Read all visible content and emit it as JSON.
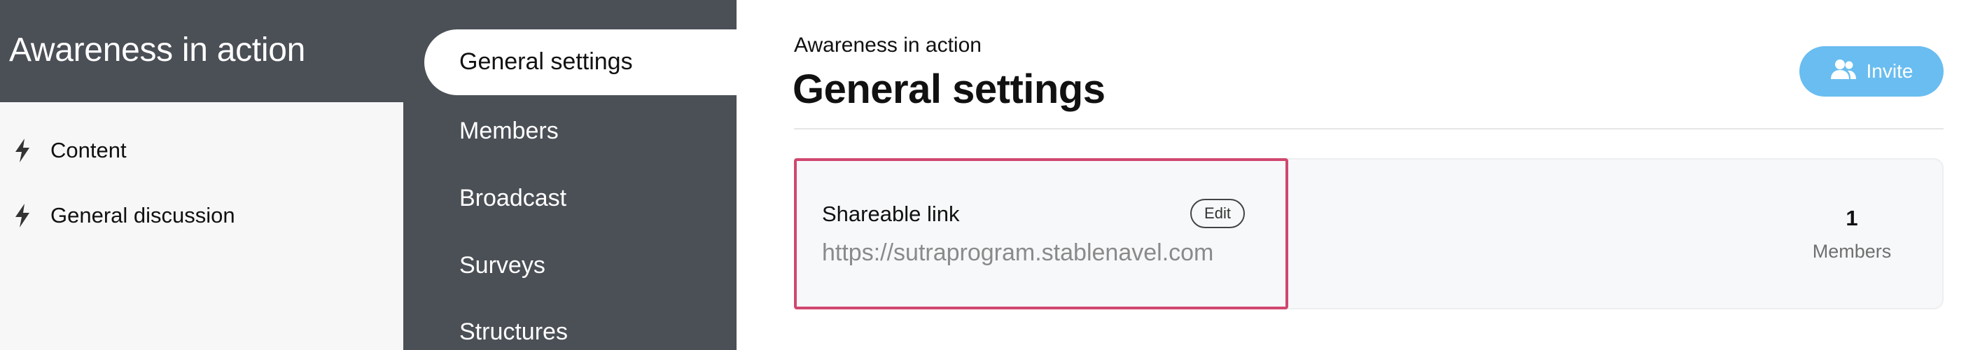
{
  "sidebar": {
    "space_title": "Awareness in action",
    "channels": [
      {
        "label": "Content",
        "icon": "bolt-icon"
      },
      {
        "label": "General discussion",
        "icon": "bolt-icon"
      }
    ]
  },
  "settings_nav": {
    "items": [
      {
        "label": "General settings",
        "active": true
      },
      {
        "label": "Members",
        "active": false
      },
      {
        "label": "Broadcast",
        "active": false
      },
      {
        "label": "Surveys",
        "active": false
      },
      {
        "label": "Structures",
        "active": false
      }
    ]
  },
  "main": {
    "breadcrumb": "Awareness in action",
    "title": "General settings",
    "invite_label": "Invite",
    "shareable_link": {
      "label": "Shareable link",
      "edit_label": "Edit",
      "url": "https://sutraprogram.stablenavel.com"
    },
    "members": {
      "count": "1",
      "label": "Members"
    }
  },
  "colors": {
    "dark_panel": "#4b4f56",
    "invite_button": "#69bdf0",
    "highlight_border": "#d0476f",
    "card_background": "#f7f8fa"
  }
}
